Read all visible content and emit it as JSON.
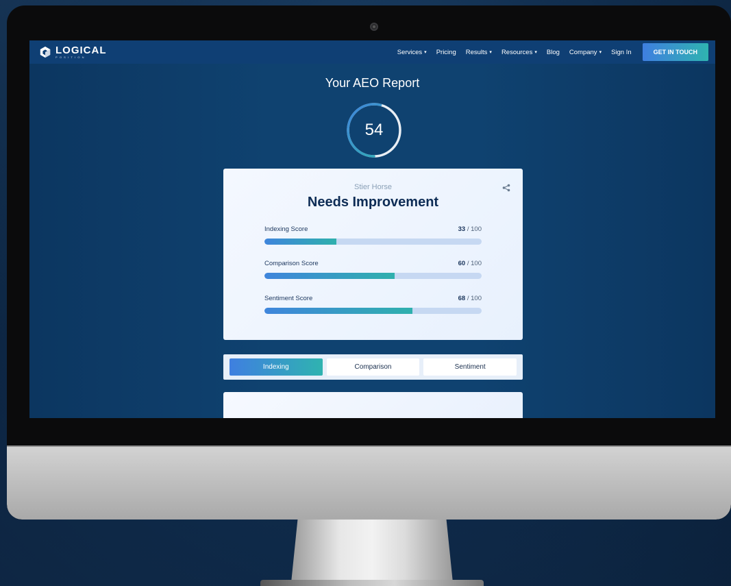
{
  "nav": {
    "logo": {
      "word": "LOGICAL",
      "sub": "POSITION"
    },
    "items": [
      {
        "label": "Services",
        "dropdown": true
      },
      {
        "label": "Pricing",
        "dropdown": false
      },
      {
        "label": "Results",
        "dropdown": true
      },
      {
        "label": "Resources",
        "dropdown": true
      },
      {
        "label": "Blog",
        "dropdown": false
      },
      {
        "label": "Company",
        "dropdown": true
      },
      {
        "label": "Sign In",
        "dropdown": false
      }
    ],
    "cta": "GET IN TOUCH"
  },
  "report": {
    "title": "Your AEO Report",
    "score": "54",
    "score_fraction": 0.54
  },
  "card": {
    "subject": "Stier Horse",
    "verdict": "Needs Improvement",
    "share_icon": "share-icon",
    "metrics": [
      {
        "label": "Indexing Score",
        "value": "33",
        "out_of": "/ 100",
        "fraction": 0.33
      },
      {
        "label": "Comparison Score",
        "value": "60",
        "out_of": "/ 100",
        "fraction": 0.6
      },
      {
        "label": "Sentiment Score",
        "value": "68",
        "out_of": "/ 100",
        "fraction": 0.68
      }
    ]
  },
  "tabs": [
    {
      "label": "Indexing",
      "active": true
    },
    {
      "label": "Comparison",
      "active": false
    },
    {
      "label": "Sentiment",
      "active": false
    }
  ],
  "colors": {
    "accent_blue": "#3f7fe0",
    "accent_teal": "#2fb3b0",
    "heading": "#0d2c55",
    "navbar": "#0f3f74"
  }
}
